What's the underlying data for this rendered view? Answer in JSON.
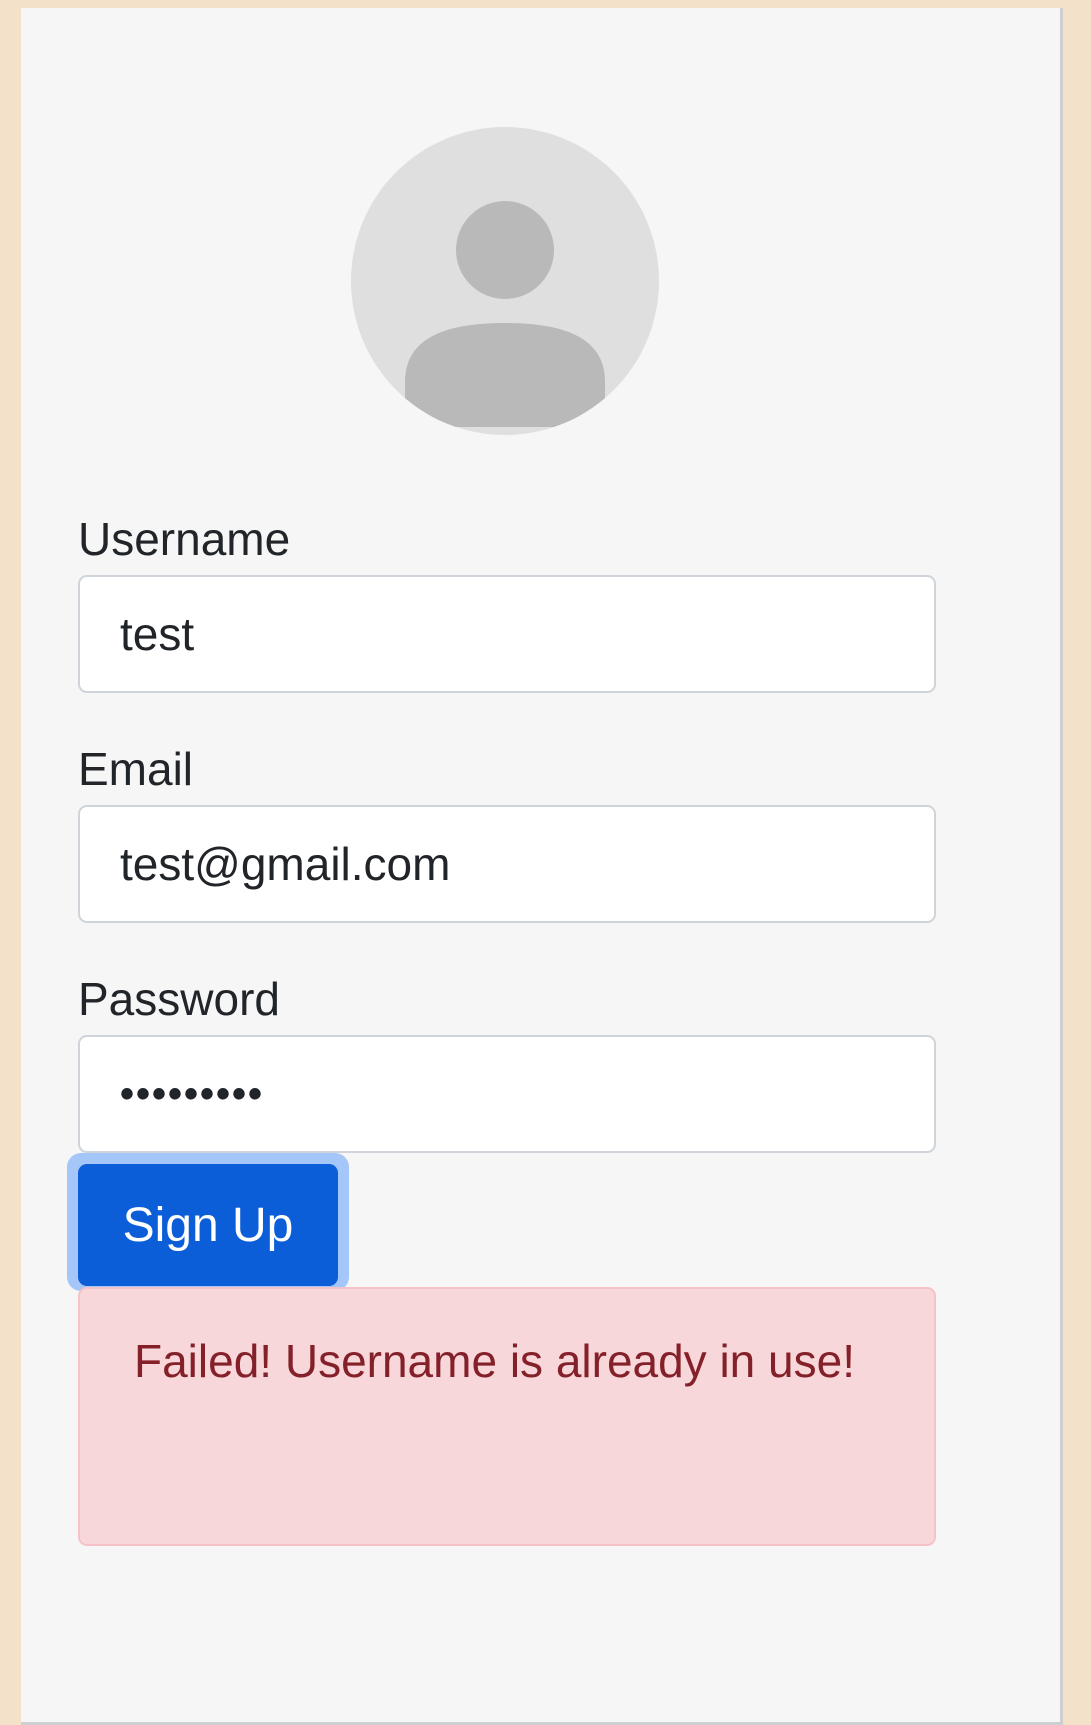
{
  "form": {
    "username": {
      "label": "Username",
      "value": "test"
    },
    "email": {
      "label": "Email",
      "value": "test@gmail.com"
    },
    "password": {
      "label": "Password",
      "value": "•••••••••"
    },
    "submit_label": "Sign Up"
  },
  "alert": {
    "message": "Failed! Username is already in use!",
    "color": "#842029",
    "background": "#f8d7da"
  },
  "avatar": {
    "icon": "user-placeholder-icon"
  },
  "colors": {
    "primary": "#0b5ed7",
    "page_background": "#f3e1c9",
    "card_background": "#f6f6f7"
  }
}
